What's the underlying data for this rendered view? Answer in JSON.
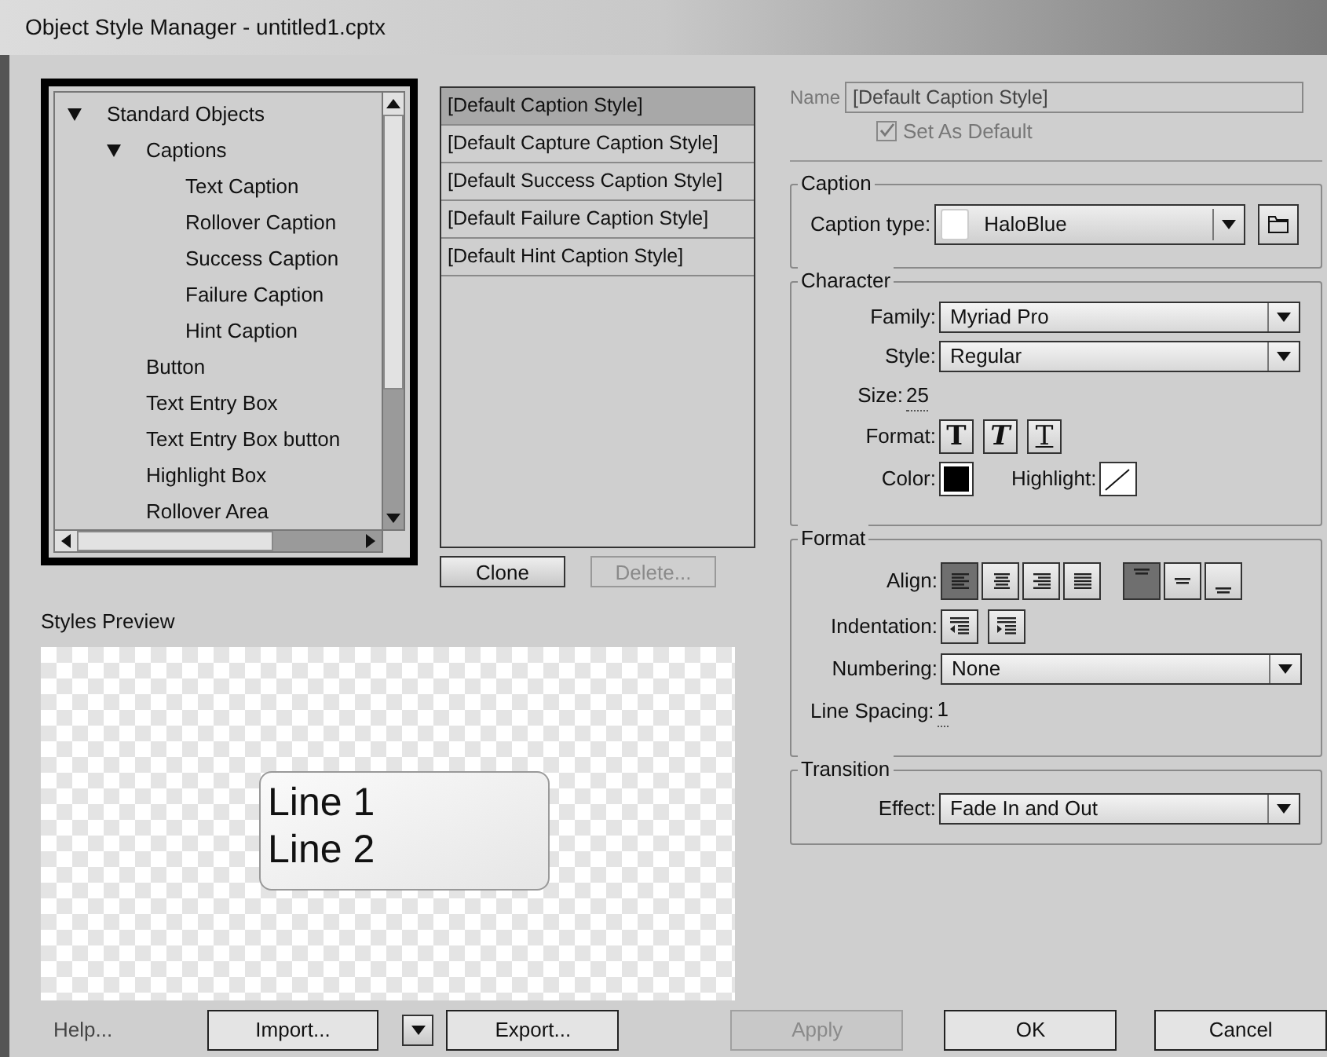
{
  "window": {
    "title": "Object Style Manager - untitled1.cptx"
  },
  "tree": [
    {
      "label": "Standard Objects",
      "expanded": true,
      "children": [
        {
          "label": "Captions",
          "expanded": true,
          "children": [
            {
              "label": "Text Caption"
            },
            {
              "label": "Rollover Caption"
            },
            {
              "label": "Success Caption"
            },
            {
              "label": "Failure Caption"
            },
            {
              "label": "Hint Caption"
            }
          ]
        },
        {
          "label": "Button"
        },
        {
          "label": "Text Entry Box"
        },
        {
          "label": "Text Entry Box button"
        },
        {
          "label": "Highlight Box"
        },
        {
          "label": "Rollover Area"
        }
      ]
    }
  ],
  "styles": [
    {
      "label": "[Default Caption Style]",
      "selected": true
    },
    {
      "label": "[Default Capture Caption Style]",
      "selected": false
    },
    {
      "label": "[Default Success Caption Style]",
      "selected": false
    },
    {
      "label": "[Default Failure Caption Style]",
      "selected": false
    },
    {
      "label": "[Default Hint Caption Style]",
      "selected": false
    }
  ],
  "list_buttons": [
    {
      "label": "Clone",
      "disabled": false
    },
    {
      "label": "Delete...",
      "disabled": true
    }
  ],
  "preview": {
    "title": "Styles Preview",
    "lines": [
      "Line 1",
      "Line 2"
    ]
  },
  "name": {
    "label": "Name",
    "value": "[Default Caption Style]"
  },
  "set_as_default": {
    "label": "Set As Default",
    "checked": true,
    "disabled": true
  },
  "caption": {
    "title": "Caption",
    "type_label": "Caption type:",
    "type_value": "HaloBlue"
  },
  "character": {
    "title": "Character",
    "family_label": "Family:",
    "family": "Myriad Pro",
    "style_label": "Style:",
    "style": "Regular",
    "size_label": "Size:",
    "size": "25",
    "format_label": "Format:",
    "format_buttons": [
      {
        "kind": "bold",
        "glyph": "T"
      },
      {
        "kind": "italic",
        "glyph": "T"
      },
      {
        "kind": "underline",
        "glyph": "T"
      }
    ],
    "color_label": "Color:",
    "highlight_label": "Highlight:"
  },
  "format": {
    "title": "Format",
    "align_label": "Align:",
    "align_buttons": [
      {
        "kind": "left",
        "selected": true
      },
      {
        "kind": "center",
        "selected": false
      },
      {
        "kind": "right",
        "selected": false
      },
      {
        "kind": "justify",
        "selected": false
      },
      {
        "kind": "top",
        "selected": true
      },
      {
        "kind": "middle",
        "selected": false
      },
      {
        "kind": "bottom",
        "selected": false
      }
    ],
    "indentation_label": "Indentation:",
    "numbering_label": "Numbering:",
    "numbering": "None",
    "line_spacing_label": "Line Spacing:",
    "line_spacing": "1"
  },
  "transition": {
    "title": "Transition",
    "effect_label": "Effect:",
    "effect": "Fade In and Out"
  },
  "footer": [
    {
      "label": "Help...",
      "kind": "link"
    },
    {
      "label": "Import...",
      "kind": "button",
      "disabled": false
    },
    {
      "label": "Export...",
      "kind": "split",
      "disabled": false
    },
    {
      "label": "Apply",
      "kind": "button",
      "disabled": true
    },
    {
      "label": "OK",
      "kind": "button",
      "disabled": false
    },
    {
      "label": "Cancel",
      "kind": "button",
      "disabled": false
    }
  ]
}
